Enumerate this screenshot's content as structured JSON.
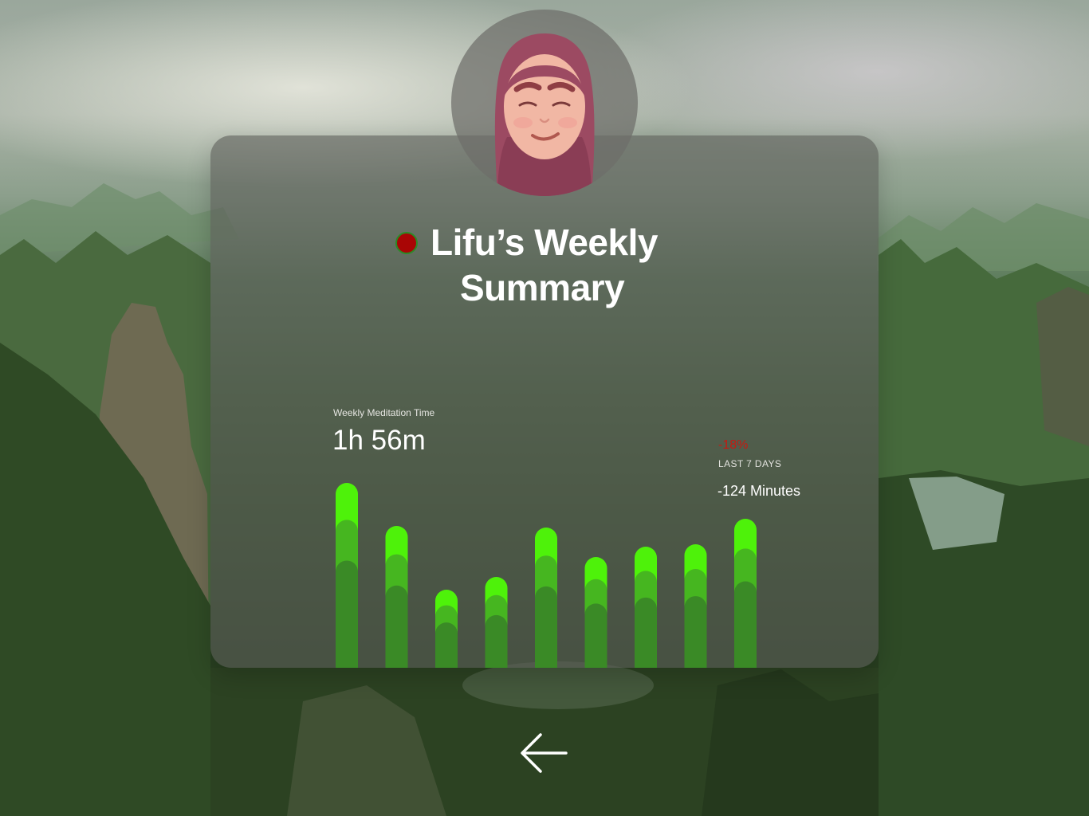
{
  "header": {
    "title_line1": "Lifu’s Weekly",
    "title_line2": "Summary",
    "status_color": "#a90505"
  },
  "metric": {
    "label": "Weekly Meditation Time",
    "value": "1h 56m"
  },
  "change": {
    "percent": "-18%",
    "period": "LAST 7 DAYS",
    "minutes": "-124 Minutes",
    "percent_color": "#c41a12"
  },
  "chart_data": {
    "type": "bar",
    "values": [
      232,
      178,
      98,
      114,
      176,
      139,
      152,
      155,
      187
    ],
    "ylim": [
      0,
      248
    ],
    "bar_colors": [
      "#4ef20a",
      "#46b620",
      "#3a8a26"
    ]
  },
  "icons": {
    "avatar": "avatar-icon",
    "back": "arrow-left-icon"
  }
}
